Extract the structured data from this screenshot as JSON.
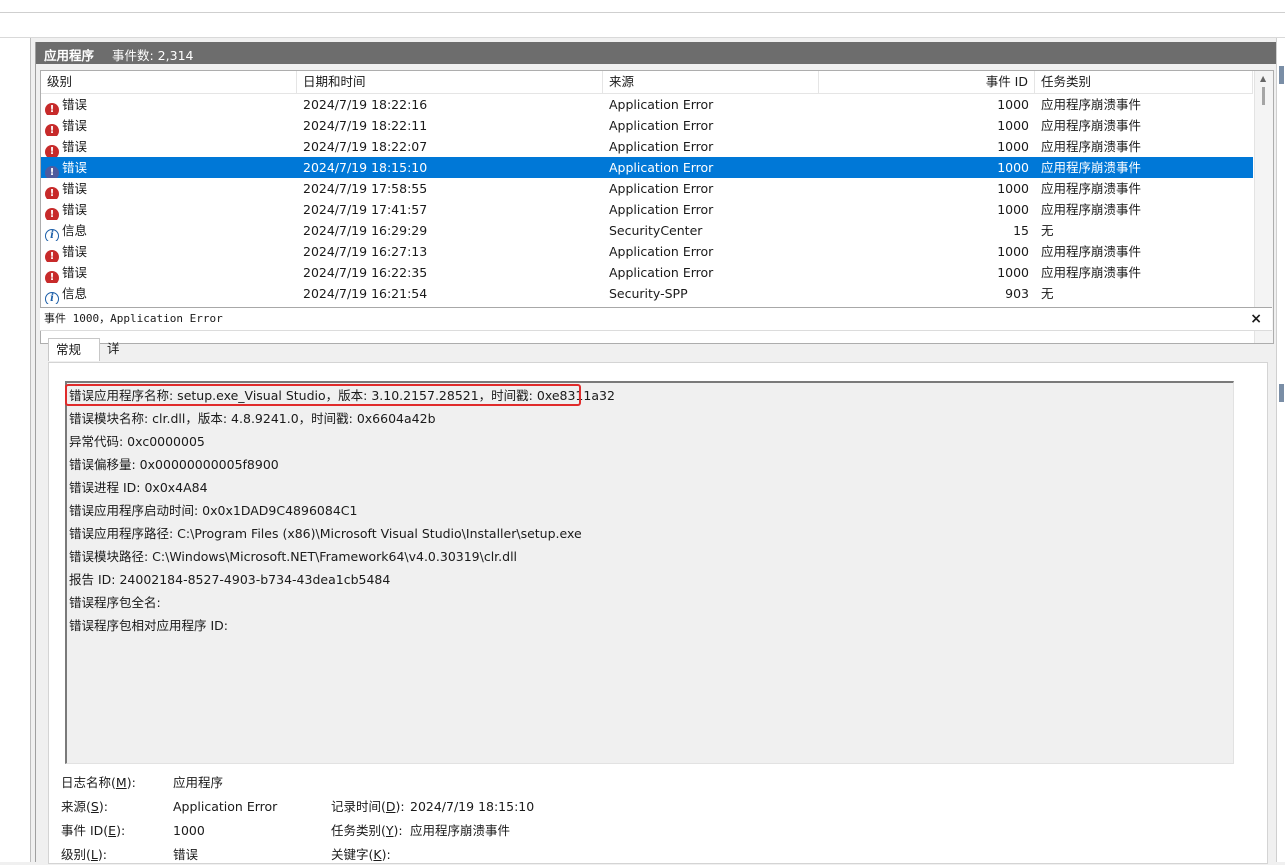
{
  "header": {
    "title": "应用程序",
    "event_count_label": "事件数: 2,314"
  },
  "columns": [
    "级别",
    "日期和时间",
    "来源",
    "事件 ID",
    "任务类别"
  ],
  "events": [
    {
      "level": "错误",
      "level_icon": "error-icon",
      "datetime": "2024/7/19 18:22:16",
      "source": "Application Error",
      "event_id": "1000",
      "task": "应用程序崩溃事件"
    },
    {
      "level": "错误",
      "level_icon": "error-icon",
      "datetime": "2024/7/19 18:22:11",
      "source": "Application Error",
      "event_id": "1000",
      "task": "应用程序崩溃事件"
    },
    {
      "level": "错误",
      "level_icon": "error-icon",
      "datetime": "2024/7/19 18:22:07",
      "source": "Application Error",
      "event_id": "1000",
      "task": "应用程序崩溃事件"
    },
    {
      "level": "错误",
      "level_icon": "error-icon",
      "datetime": "2024/7/19 18:15:10",
      "source": "Application Error",
      "event_id": "1000",
      "task": "应用程序崩溃事件",
      "selected": true
    },
    {
      "level": "错误",
      "level_icon": "error-icon",
      "datetime": "2024/7/19 17:58:55",
      "source": "Application Error",
      "event_id": "1000",
      "task": "应用程序崩溃事件"
    },
    {
      "level": "错误",
      "level_icon": "error-icon",
      "datetime": "2024/7/19 17:41:57",
      "source": "Application Error",
      "event_id": "1000",
      "task": "应用程序崩溃事件"
    },
    {
      "level": "信息",
      "level_icon": "info-icon",
      "datetime": "2024/7/19 16:29:29",
      "source": "SecurityCenter",
      "event_id": "15",
      "task": "无"
    },
    {
      "level": "错误",
      "level_icon": "error-icon",
      "datetime": "2024/7/19 16:27:13",
      "source": "Application Error",
      "event_id": "1000",
      "task": "应用程序崩溃事件"
    },
    {
      "level": "错误",
      "level_icon": "error-icon",
      "datetime": "2024/7/19 16:22:35",
      "source": "Application Error",
      "event_id": "1000",
      "task": "应用程序崩溃事件"
    },
    {
      "level": "信息",
      "level_icon": "info-icon",
      "datetime": "2024/7/19 16:21:54",
      "source": "Security-SPP",
      "event_id": "903",
      "task": "无"
    }
  ],
  "detail": {
    "title": "事件 1000，Application Error",
    "close_label": "×",
    "tabs": [
      "常规",
      "详细信息"
    ],
    "description_lines": [
      "错误应用程序名称: setup.exe_Visual Studio，版本: 3.10.2157.28521，时间戳: 0xe8311a32",
      "错误模块名称: clr.dll，版本: 4.8.9241.0，时间戳: 0x6604a42b",
      "异常代码: 0xc0000005",
      "错误偏移量: 0x00000000005f8900",
      "错误进程 ID: 0x0x4A84",
      "错误应用程序启动时间: 0x0x1DAD9C4896084C1",
      "错误应用程序路径: C:\\Program Files (x86)\\Microsoft Visual Studio\\Installer\\setup.exe",
      "错误模块路径: C:\\Windows\\Microsoft.NET\\Framework64\\v4.0.30319\\clr.dll",
      "报告 ID: 24002184-8527-4903-b734-43dea1cb5484",
      "错误程序包全名:",
      "错误程序包相对应用程序 ID:"
    ],
    "properties": {
      "log_name_label": "日志名称(",
      "log_name_key": "M",
      "log_name_value": "应用程序",
      "source_label": "来源(",
      "source_key": "S",
      "source_value": "Application Error",
      "logged_label": "记录时间(",
      "logged_key": "D",
      "logged_value": "2024/7/19 18:15:10",
      "event_id_label": "事件 ID(",
      "event_id_key": "E",
      "event_id_value": "1000",
      "task_label": "任务类别(",
      "task_key": "Y",
      "task_value": "应用程序崩溃事件",
      "level_label": "级别(",
      "level_key": "L",
      "level_value": "错误",
      "keywords_label": "关键字(",
      "keywords_key": "K",
      "keywords_value": ""
    }
  }
}
